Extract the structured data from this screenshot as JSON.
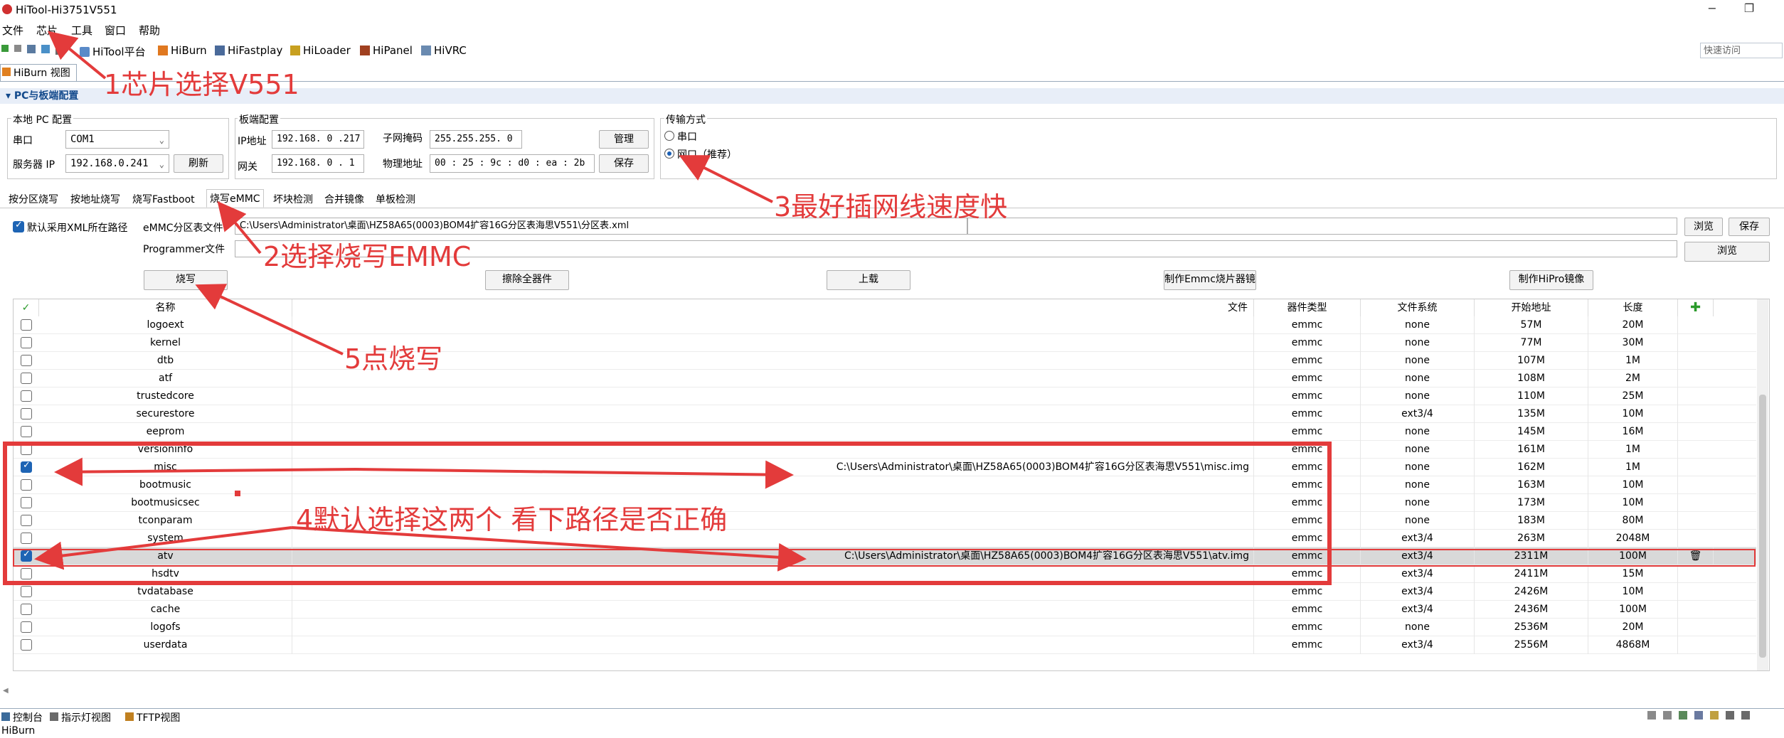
{
  "window": {
    "title": "HiTool-Hi3751V551",
    "minimize": "−",
    "restore": "❐"
  },
  "menu": [
    "文件",
    "芯片",
    "工具",
    "窗口",
    "帮助"
  ],
  "toolbar": {
    "items": [
      "HiTool平台",
      "HiBurn",
      "HiFastplay",
      "HiLoader",
      "HiPanel",
      "HiVRC"
    ],
    "quick_access": "快速访问"
  },
  "view_tab": "HiBurn 视图",
  "section": "▾ PC与板端配置",
  "local_pc": {
    "title": "本地 PC 配置",
    "serial_label": "串口",
    "serial_value": "COM1",
    "server_label": "服务器 IP",
    "server_value": "192.168.0.241",
    "refresh": "刷新"
  },
  "board": {
    "title": "板端配置",
    "ip_label": "IP地址",
    "ip_value": "192.168. 0 .217",
    "mask_label": "子网掩码",
    "mask_value": "255.255.255. 0",
    "manage": "管理",
    "gw_label": "网关",
    "gw_value": "192.168. 0 . 1",
    "mac_label": "物理地址",
    "mac_value": "00 : 25 : 9c : d0 : ea : 2b",
    "save": "保存"
  },
  "transfer": {
    "title": "传输方式",
    "serial": "串口",
    "net": "网口（推荐）"
  },
  "func_tabs": [
    "按分区烧写",
    "按地址烧写",
    "烧写Fastboot",
    "烧写eMMC",
    "坏块检测",
    "合并镜像",
    "单板检测"
  ],
  "emmc": {
    "default_xml_label": "默认采用XML所在路径",
    "table_file_label": "eMMC分区表文件",
    "table_file_value": "C:\\Users\\Administrator\\桌面\\HZ58A65(0003)BOM4扩容16G分区表海思V551\\分区表.xml",
    "programmer_label": "Programmer文件",
    "browse": "浏览",
    "save": "保存",
    "buttons": [
      "烧写",
      "擦除全器件",
      "上载",
      "制作Emmc烧片器镜",
      "制作HiPro镜像"
    ]
  },
  "table": {
    "headers": [
      "名称",
      "文件",
      "器件类型",
      "文件系统",
      "开始地址",
      "长度"
    ],
    "rows": [
      {
        "name": "logoext",
        "file": "",
        "dev": "emmc",
        "fs": "none",
        "start": "57M",
        "len": "20M",
        "checked": false
      },
      {
        "name": "kernel",
        "file": "",
        "dev": "emmc",
        "fs": "none",
        "start": "77M",
        "len": "30M",
        "checked": false
      },
      {
        "name": "dtb",
        "file": "",
        "dev": "emmc",
        "fs": "none",
        "start": "107M",
        "len": "1M",
        "checked": false
      },
      {
        "name": "atf",
        "file": "",
        "dev": "emmc",
        "fs": "none",
        "start": "108M",
        "len": "2M",
        "checked": false
      },
      {
        "name": "trustedcore",
        "file": "",
        "dev": "emmc",
        "fs": "none",
        "start": "110M",
        "len": "25M",
        "checked": false
      },
      {
        "name": "securestore",
        "file": "",
        "dev": "emmc",
        "fs": "ext3/4",
        "start": "135M",
        "len": "10M",
        "checked": false
      },
      {
        "name": "eeprom",
        "file": "",
        "dev": "emmc",
        "fs": "none",
        "start": "145M",
        "len": "16M",
        "checked": false
      },
      {
        "name": "versioninfo",
        "file": "",
        "dev": "emmc",
        "fs": "none",
        "start": "161M",
        "len": "1M",
        "checked": false
      },
      {
        "name": "misc",
        "file": "C:\\Users\\Administrator\\桌面\\HZ58A65(0003)BOM4扩容16G分区表海思V551\\misc.img",
        "dev": "emmc",
        "fs": "none",
        "start": "162M",
        "len": "1M",
        "checked": true
      },
      {
        "name": "bootmusic",
        "file": "",
        "dev": "emmc",
        "fs": "none",
        "start": "163M",
        "len": "10M",
        "checked": false
      },
      {
        "name": "bootmusicsec",
        "file": "",
        "dev": "emmc",
        "fs": "none",
        "start": "173M",
        "len": "10M",
        "checked": false
      },
      {
        "name": "tconparam",
        "file": "",
        "dev": "emmc",
        "fs": "none",
        "start": "183M",
        "len": "80M",
        "checked": false
      },
      {
        "name": "system",
        "file": "",
        "dev": "emmc",
        "fs": "ext3/4",
        "start": "263M",
        "len": "2048M",
        "checked": false
      },
      {
        "name": "atv",
        "file": "C:\\Users\\Administrator\\桌面\\HZ58A65(0003)BOM4扩容16G分区表海思V551\\atv.img",
        "dev": "emmc",
        "fs": "ext3/4",
        "start": "2311M",
        "len": "100M",
        "checked": true
      },
      {
        "name": "hsdtv",
        "file": "",
        "dev": "emmc",
        "fs": "ext3/4",
        "start": "2411M",
        "len": "15M",
        "checked": false
      },
      {
        "name": "tvdatabase",
        "file": "",
        "dev": "emmc",
        "fs": "ext3/4",
        "start": "2426M",
        "len": "10M",
        "checked": false
      },
      {
        "name": "cache",
        "file": "",
        "dev": "emmc",
        "fs": "ext3/4",
        "start": "2436M",
        "len": "100M",
        "checked": false
      },
      {
        "name": "logofs",
        "file": "",
        "dev": "emmc",
        "fs": "none",
        "start": "2536M",
        "len": "20M",
        "checked": false
      },
      {
        "name": "userdata",
        "file": "",
        "dev": "emmc",
        "fs": "ext3/4",
        "start": "2556M",
        "len": "4868M",
        "checked": false
      }
    ]
  },
  "bottom_tabs": [
    "控制台",
    "指示灯视图",
    "TFTP视图"
  ],
  "status": "HiBurn",
  "annotations": [
    "1芯片选择V551",
    "2选择烧写EMMC",
    "3最好插网线速度快",
    "4默认选择这两个 看下路径是否正确",
    "5点烧写"
  ],
  "colors": {
    "annotation": "#e33b3b",
    "accent": "#1e64b4",
    "selected_row": "#d9d9d9"
  }
}
